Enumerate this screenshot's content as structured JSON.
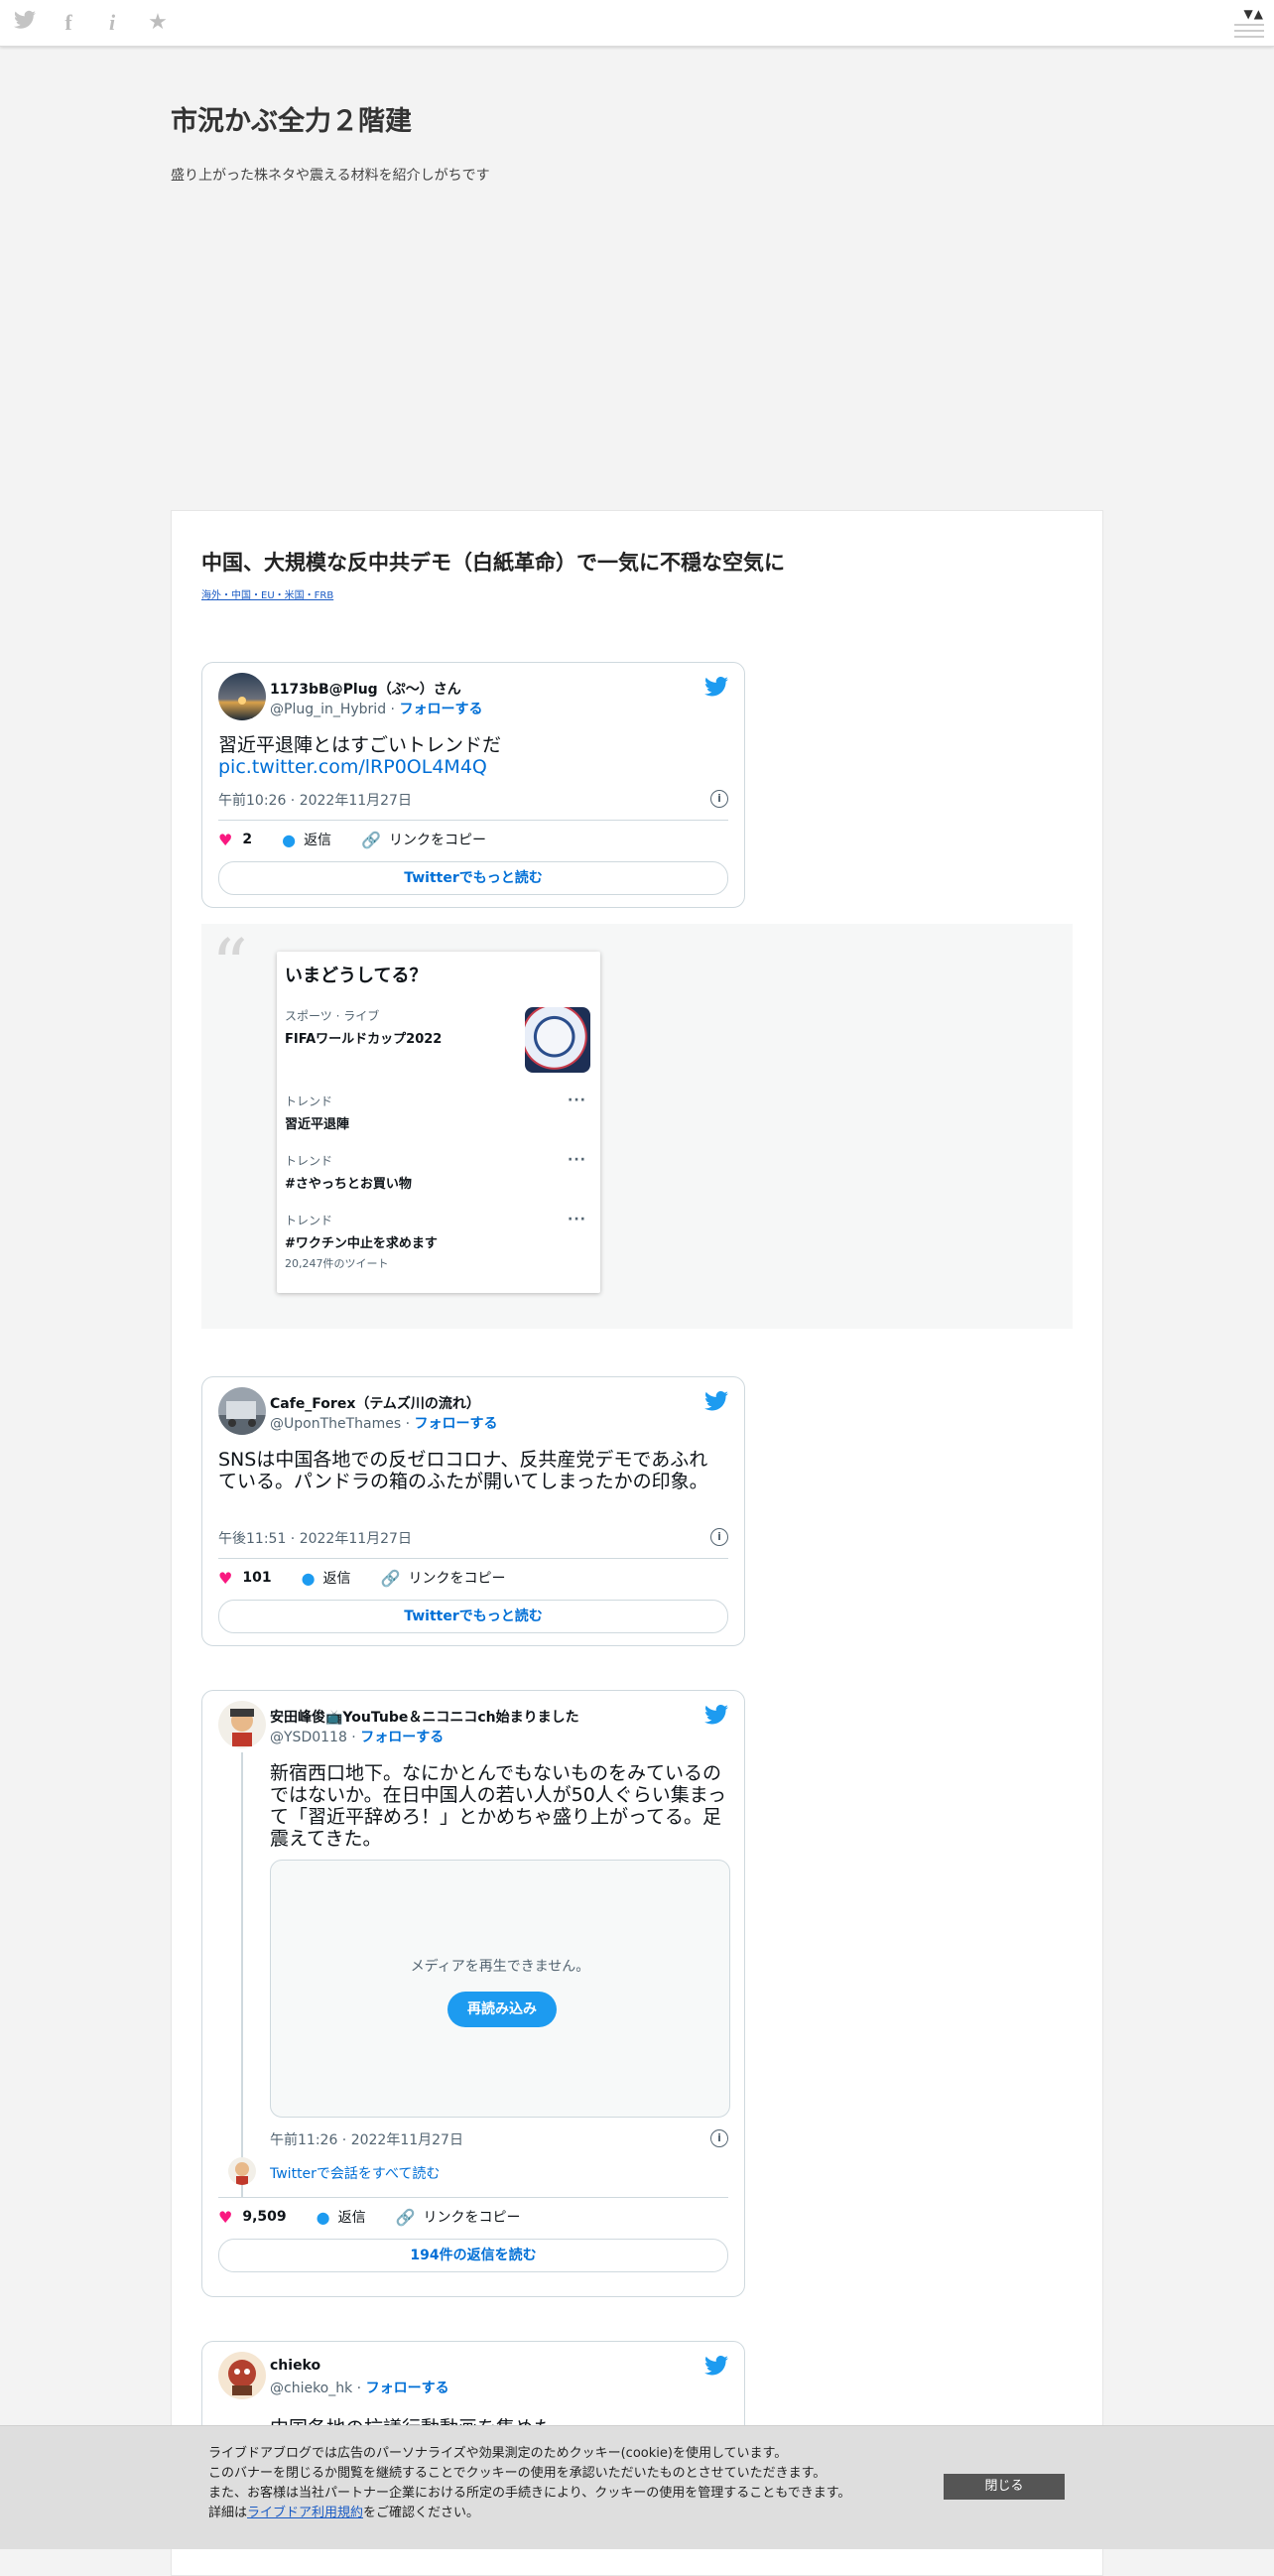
{
  "blog": {
    "title": "市況かぶ全力２階建",
    "description": "盛り上がった株ネタや震える材料を紹介しがちです"
  },
  "article": {
    "title": "中国、大規模な反中共デモ（白紙革命）で一気に不穏な空気に",
    "categories": "海外・中国・EU・米国・FRB"
  },
  "tweets": [
    {
      "name": "1173bB@Plug（ぷ～）さん",
      "handle": "@Plug_in_Hybrid",
      "sep": " · ",
      "follow": "フォローする",
      "text": "習近平退陣とはすごいトレンドだ",
      "link": "pic.twitter.com/lRP0OL4M4Q",
      "time": "午前10:26 · 2022年11月27日",
      "likes": "2",
      "reply": "返信",
      "copy": "リンクをコピー",
      "more": "Twitterでもっと読む"
    },
    {
      "name": "Cafe_Forex（テムズ川の流れ）",
      "handle": "@UponTheThames",
      "sep": " · ",
      "follow": "フォローする",
      "text": "SNSは中国各地での反ゼロコロナ、反共産党デモであふれている。パンドラの箱のふたが開いてしまったかの印象。",
      "time": "午後11:51 · 2022年11月27日",
      "likes": "101",
      "reply": "返信",
      "copy": "リンクをコピー",
      "more": "Twitterでもっと読む"
    },
    {
      "name": "安田峰俊📺YouTube＆ニコニコch始まりました",
      "handle": "@YSD0118",
      "sep": " · ",
      "follow": "フォローする",
      "text": "新宿西口地下。なにかとんでもないものをみているのではないか。在日中国人の若い人が50人ぐらい集まって「習近平辞めろ！」とかめちゃ盛り上がってる。足震えてきた。",
      "media_message": "メディアを再生できません。",
      "media_button": "再読み込み",
      "time": "午前11:26 · 2022年11月27日",
      "conversation": "Twitterで会話をすべて読む",
      "likes": "9,509",
      "reply": "返信",
      "copy": "リンクをコピー",
      "more": "194件の返信を読む"
    },
    {
      "name": "chieko",
      "handle": "@chieko_hk",
      "sep": " · ",
      "follow": "フォローする",
      "text": "中国各地の抗議行動動画を集めた"
    }
  ],
  "trends": {
    "heading": "いまどうしてる？",
    "items": [
      {
        "category": "スポーツ · ライブ",
        "name": "FIFAワールドカップ2022"
      },
      {
        "category": "トレンド",
        "name": "習近平退陣"
      },
      {
        "category": "トレンド",
        "name": "#さやっちとお買い物"
      },
      {
        "category": "トレンド",
        "name": "#ワクチン中止を求めます",
        "sub": "20,247件のツイート"
      }
    ]
  },
  "cookie": {
    "line1": "ライブドアブログでは広告のパーソナライズや効果測定のためクッキー(cookie)を使用しています。",
    "line2": "このバナーを閉じるか閲覧を継続することでクッキーの使用を承認いただいたものとさせていただきます。",
    "line3": "また、お客様は当社パートナー企業における所定の手続きにより、クッキーの使用を管理することもできます。",
    "line4_pre": "詳細は",
    "line4_link": "ライブドア利用規約",
    "line4_post": "をご確認ください。",
    "close": "閉じる"
  },
  "colors": {
    "twitter_blue": "#1d9bf0",
    "like_pink": "#f91880",
    "link_blue": "#006fd6"
  },
  "icons": {
    "topbar": [
      "twitter-icon",
      "facebook-icon",
      "info-icon",
      "star-icon"
    ],
    "tweet": [
      "twitter-bird-icon",
      "heart-icon",
      "reply-icon",
      "link-icon",
      "info-icon"
    ],
    "menu": [
      "up-down-arrows-icon",
      "hamburger-icon"
    ]
  }
}
